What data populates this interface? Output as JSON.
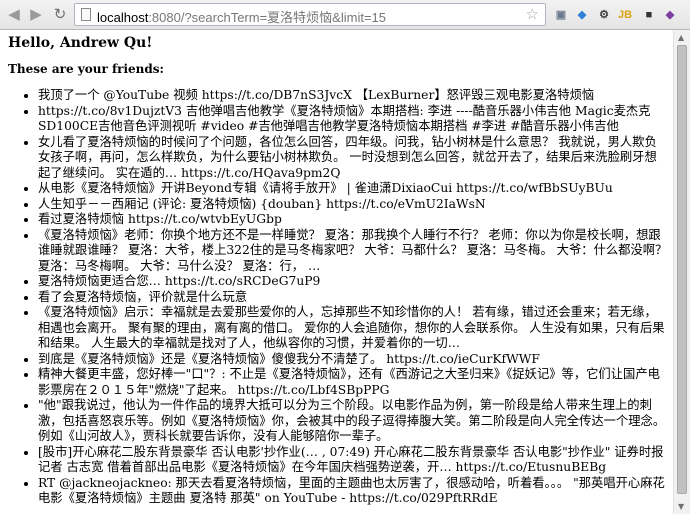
{
  "browser": {
    "url_host": "localhost",
    "url_rest": ":8080/?searchTerm=夏洛特烦恼&limit=15",
    "extensions": [
      {
        "icon": "puzzle-extension-icon",
        "glyph": "▣",
        "color": "#6b7b8c"
      },
      {
        "icon": "tag-extension-icon",
        "glyph": "◆",
        "color": "#2f7fd6"
      },
      {
        "icon": "settings-gear-icon",
        "glyph": "⚙",
        "color": "#444"
      },
      {
        "icon": "jb-extension-icon",
        "glyph": "JB",
        "color": "#d9a514"
      },
      {
        "icon": "camera-extension-icon",
        "glyph": "■",
        "color": "#333"
      },
      {
        "icon": "shield-extension-icon",
        "glyph": "◆",
        "color": "#7a3fa0"
      },
      {
        "icon": "globe-extension-icon",
        "glyph": "●",
        "color": "#2e8b57"
      },
      {
        "icon": "menu-icon",
        "glyph": "≡",
        "color": "#555"
      }
    ]
  },
  "page": {
    "greeting": "Hello, Andrew Qu!",
    "friends_heading": "These are your friends:",
    "tweets": [
      "我顶了一个 @YouTube 视频 https://t.co/DB7nS3JvcX 【LexBurner】怒评毁三观电影夏洛特烦恼",
      "https://t.co/8v1DujztV3 吉他弹唱吉他教学《夏洛特烦恼》本期搭档: 李进 ----酷音乐器小伟吉他 Magic麦杰克SD100CE吉他音色评测视听 #video #吉他弹唱吉他教学夏洛特烦恼本期搭档 #李进 #酷音乐器小伟吉他",
      "女儿看了夏洛特烦恼的时候问了个问题，各位怎么回答，四年级。问我，钻小树林是什么意思？ 我就说，男人欺负女孩子啊，再问，怎么样欺负，为什么要钻小树林欺负。 一时没想到怎么回答，就岔开去了，结果后来洗脸刷牙想起了继续问。 实在遁的… https://t.co/HQava9pm2Q",
      "从电影《夏洛特烦恼》开讲Beyond专辑《请将手放开》 | 雀迪潇DixiaoCui https://t.co/wfBbSUyBUu",
      "人生知乎－－西厢记 (评论: 夏洛特烦恼) {douban} https://t.co/eVmU2IaWsN",
      "看过夏洛特烦恼 https://t.co/wtvbEyUGbp",
      "《夏洛特烦恼》老师：你换个地方还不是一样睡觉？ 夏洛：那我换个人睡行不行？ 老师：你以为你是校长啊，想跟谁睡就跟谁睡？ 夏洛：大爷，楼上322住的是马冬梅家吧？ 大爷：马都什么？ 夏洛：马冬梅。 大爷：什么都没啊？ 夏洛：马冬梅啊。 大爷：马什么没？ 夏洛：行， …",
      "夏洛特烦恼更适合您… https://t.co/sRCDeG7uP9",
      "看了会夏洛特烦恼，评价就是什么玩意",
      "《夏洛特烦恼》启示：幸福就是去爱那些爱你的人，忘掉那些不知珍惜你的人！ 若有缘，错过还会重来；若无缘，相遇也会离开。 聚有聚的理由，离有离的借口。 爱你的人会追随你，想你的人会联系你。 人生没有如果，只有后果和结果。 人生最大的幸福就是找对了人，他纵容你的习惯，并爱着你的一切…",
      "到底是《夏洛特烦恼》还是《夏洛特烦恼》傻傻我分不清楚了。 https://t.co/ieCurKfWWF",
      "精神大餐更丰盛，您好棒一\"口\"？: 不止是《夏洛特烦恼》，还有《西游记之大圣归来》《捉妖记》等，它们让国产电影票房在２０１５年\"燃烧\"了起来。 https://t.co/Lbf4SBpPPG",
      "\"他\"跟我说过，他认为一件作品的境界大抵可以分为三个阶段。以电影作品为例，第一阶段是给人带来生理上的刺激，包括喜怒哀乐等。例如《夏洛特烦恼》你，会被其中的段子逗得捧腹大笑。第二阶段是向人完全传达一个理念。例如《山河故人》，贾科长就要告诉你，没有人能够陪你一辈子。",
      "[股市]开心麻花二股东背景豪华 否认电影'抄作业(…  , 07:49)         开心麻花二股东背景豪华 否认电影\"抄作业\"    证券时报记者 古志宽        借着首部出品电影《夏洛特烦恼》在今年国庆档强势逆袭，开… https://t.co/EtusnuBEBg",
      "RT @jackneojackneo: 那天去看夏洛特烦恼，里面的主题曲也太厉害了，很感动哈，听着看。。。 \"那英唱开心麻花电影《夏洛特烦恼》主题曲 夏洛特 那英\" on YouTube - https://t.co/029PftRRdE"
    ]
  }
}
